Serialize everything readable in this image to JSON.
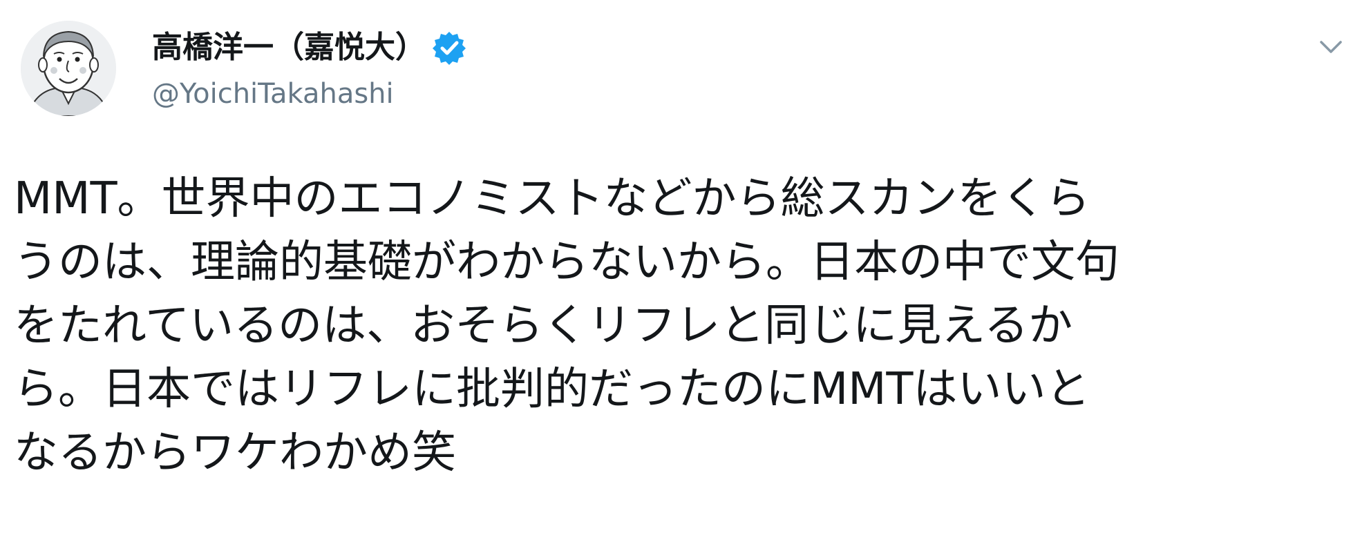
{
  "author": {
    "display_name": "高橋洋一（嘉悦大）",
    "username": "@YoichiTakahashi",
    "verified": true,
    "avatar_icon": "caricature-avatar"
  },
  "controls": {
    "caret_icon": "chevron-down-icon"
  },
  "tweet": {
    "lines": [
      "MMT。世界中のエコノミストなどから総スカンをくら",
      "うのは、理論的基礎がわからないから。日本の中で文句",
      "をたれているのは、おそらくリフレと同じに見えるか",
      "ら。日本ではリフレに批判的だったのにMMTはいいと",
      "なるからワケわかめ笑"
    ]
  },
  "colors": {
    "text": "#14171a",
    "secondary_text": "#657786",
    "verified_blue": "#1da1f2",
    "caret": "#8899a6"
  }
}
